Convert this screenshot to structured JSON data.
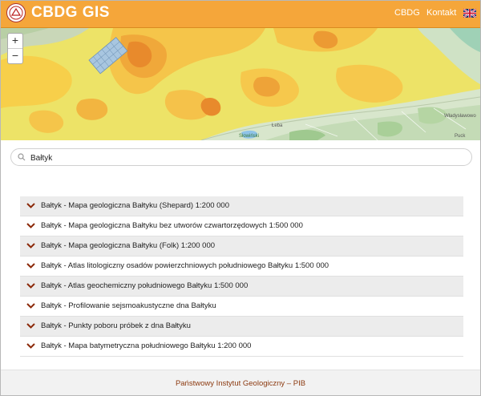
{
  "header": {
    "brand": "CBDG GIS",
    "nav": [
      {
        "label": "CBDG"
      },
      {
        "label": "Kontakt"
      }
    ],
    "language_icon": "uk-flag-icon",
    "colors": {
      "bar": "#f5a63a",
      "text": "#ffffff"
    }
  },
  "map": {
    "zoom_in": "+",
    "zoom_out": "−",
    "labels": [
      "Łeba",
      "Władysławowo",
      "Słowiński",
      "Puck"
    ]
  },
  "search": {
    "value": "Bałtyk",
    "placeholder": ""
  },
  "results": [
    {
      "label": "Bałtyk - Mapa geologiczna Bałtyku (Shepard) 1:200 000"
    },
    {
      "label": "Bałtyk - Mapa geologiczna Bałtyku bez utworów czwartorzędowych 1:500 000"
    },
    {
      "label": "Bałtyk - Mapa geologiczna Bałtyku (Folk) 1:200 000"
    },
    {
      "label": "Bałtyk - Atlas litologiczny osadów powierzchniowych południowego Bałtyku 1:500 000"
    },
    {
      "label": "Bałtyk - Atlas geochemiczny południowego Bałtyku 1:500 000"
    },
    {
      "label": "Bałtyk - Profilowanie sejsmoakustyczne dna Bałtyku"
    },
    {
      "label": "Bałtyk - Punkty poboru próbek z dna Bałtyku"
    },
    {
      "label": "Bałtyk - Mapa batymetryczna południowego Bałtyku 1:200 000"
    }
  ],
  "footer": {
    "text": "Państwowy Instytut Geologiczny – PIB",
    "color": "#8c3a10"
  }
}
